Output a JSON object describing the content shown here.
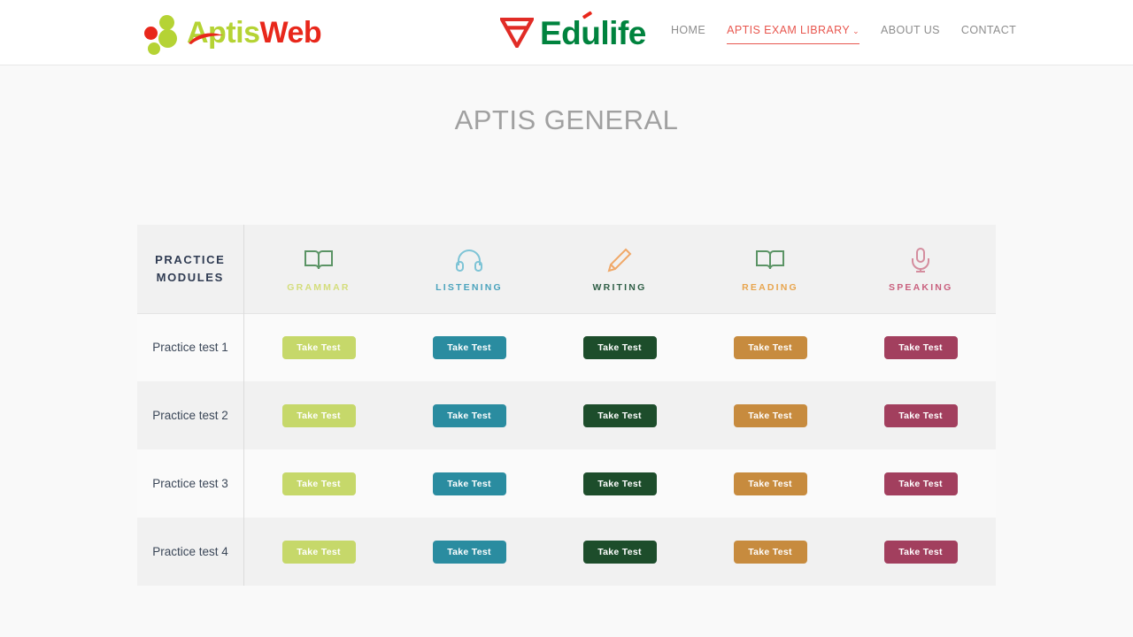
{
  "header": {
    "brand_left": {
      "name": "AptisWeb",
      "part_one": "Aptis",
      "part_two": "Web",
      "color_green": "#b5d334",
      "color_red": "#e8271b"
    },
    "brand_center": {
      "name": "Edulife",
      "color_green": "#00833e",
      "color_red": "#e8271b"
    },
    "nav": [
      {
        "label": "HOME",
        "active": false,
        "has_caret": false
      },
      {
        "label": "APTIS EXAM LIBRARY",
        "active": true,
        "has_caret": true,
        "caret": "⌄"
      },
      {
        "label": "ABOUT US",
        "active": false,
        "has_caret": false
      },
      {
        "label": "CONTACT",
        "active": false,
        "has_caret": false
      }
    ],
    "active_nav_color": "#e8574f",
    "nav_color": "#8d8d8d"
  },
  "main": {
    "page_title": "APTIS GENERAL",
    "page_title_color": "#a0a0a0"
  },
  "table": {
    "corner_header_line1": "PRACTICE",
    "corner_header_line2": "MODULES",
    "corner_header_color": "#2f3b52",
    "modules": [
      {
        "label": "GRAMMAR",
        "icon": "open-book-icon",
        "label_color": "#d4dd7b",
        "icon_color": "#5b9465",
        "button_color": "#c6d86a"
      },
      {
        "label": "LISTENING",
        "icon": "headphones-icon",
        "label_color": "#4ba3bd",
        "icon_color": "#7ec4d6",
        "button_color": "#2a8ca0"
      },
      {
        "label": "WRITING",
        "icon": "pencil-icon",
        "label_color": "#2f5e46",
        "icon_color": "#f0a868",
        "button_color": "#1d4d2b"
      },
      {
        "label": "READING",
        "icon": "open-book-icon",
        "label_color": "#e8a54e",
        "icon_color": "#5b9465",
        "button_color": "#c78b3e"
      },
      {
        "label": "SPEAKING",
        "icon": "microphone-icon",
        "label_color": "#c9607e",
        "icon_color": "#d48d9e",
        "button_color": "#a23f5e"
      }
    ],
    "button_label": "Take Test",
    "rows": [
      {
        "name": "Practice test 1"
      },
      {
        "name": "Practice test 2"
      },
      {
        "name": "Practice test 3"
      },
      {
        "name": "Practice test 4"
      }
    ]
  }
}
